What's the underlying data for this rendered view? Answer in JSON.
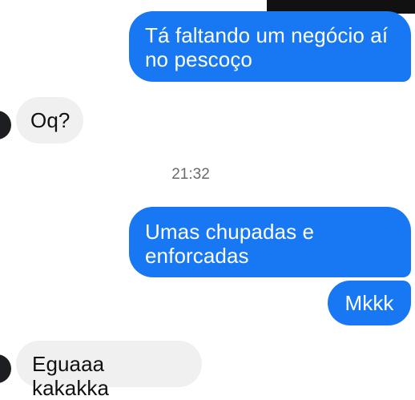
{
  "messages": [
    {
      "direction": "outgoing",
      "text": "Tá faltando um negócio aí no pescoço"
    },
    {
      "direction": "incoming",
      "text": "Oq?"
    },
    {
      "direction": "outgoing",
      "text": "Umas chupadas e enforcadas"
    },
    {
      "direction": "outgoing",
      "text": "Mkkk"
    },
    {
      "direction": "incoming",
      "text": "Eguaaa kakakka"
    }
  ],
  "timestamp": "21:32",
  "colors": {
    "outgoing_bubble": "#1877f2",
    "incoming_bubble": "#f0f0f0",
    "timestamp_text": "#6b6b6b"
  },
  "icons": {
    "contact_avatar": "avatar-circle"
  }
}
